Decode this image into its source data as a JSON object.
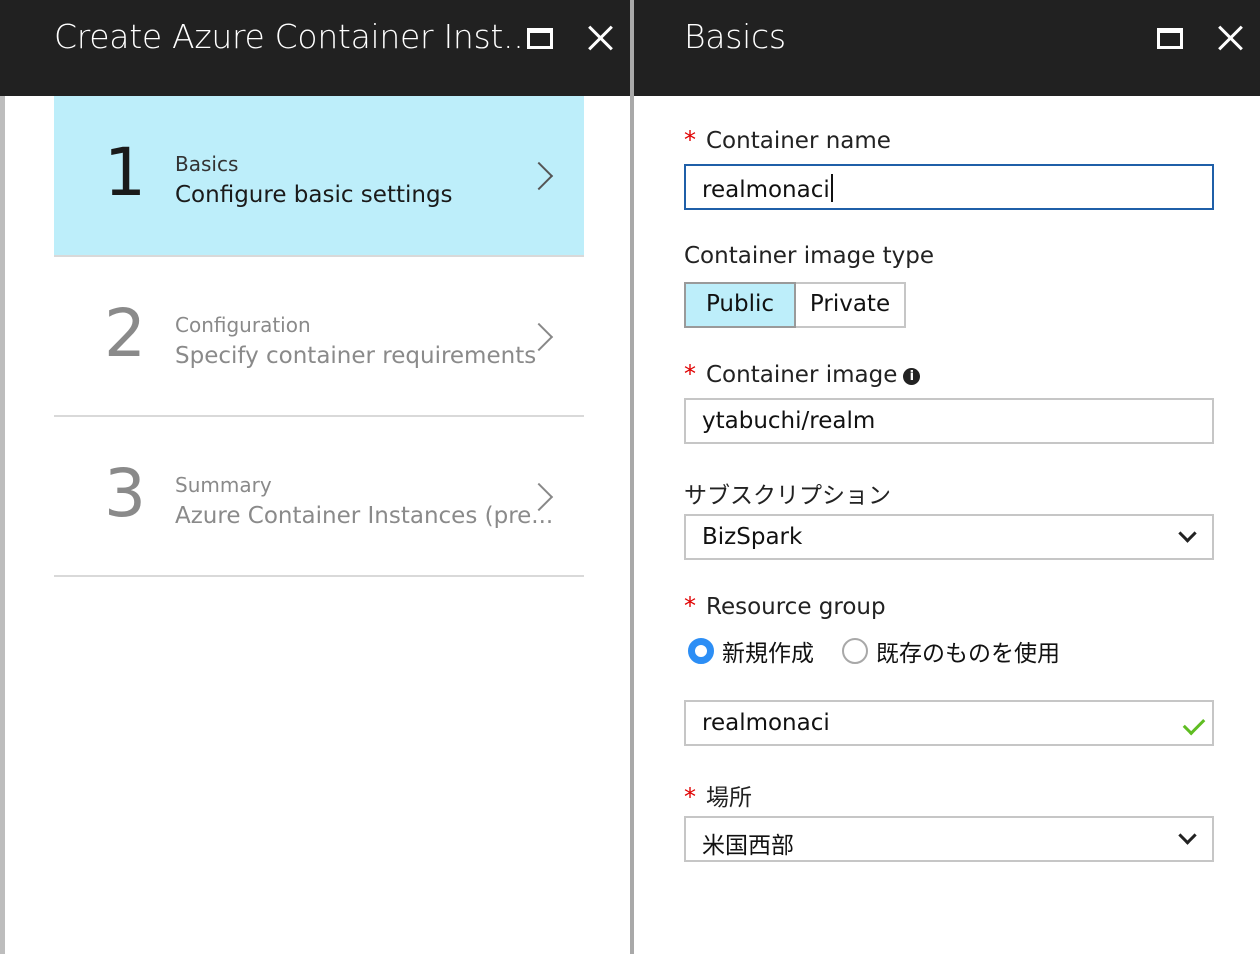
{
  "left_blade": {
    "title": "Create Azure Container Inst...",
    "steps": [
      {
        "number": "1",
        "title": "Basics",
        "subtitle": "Configure basic settings"
      },
      {
        "number": "2",
        "title": "Configuration",
        "subtitle": "Specify container requirements"
      },
      {
        "number": "3",
        "title": "Summary",
        "subtitle": "Azure Container Instances (pre..."
      }
    ]
  },
  "right_blade": {
    "title": "Basics",
    "container_name": {
      "label": "Container name",
      "value": "realmonaci"
    },
    "image_type": {
      "label": "Container image type",
      "options": [
        "Public",
        "Private"
      ],
      "selected": "Public"
    },
    "container_image": {
      "label": "Container image",
      "value": "ytabuchi/realm"
    },
    "subscription": {
      "label": "サブスクリプション",
      "value": "BizSpark"
    },
    "resource_group": {
      "label": "Resource group",
      "options": [
        "新規作成",
        "既存のものを使用"
      ],
      "selected": "新規作成",
      "value": "realmonaci"
    },
    "location": {
      "label": "場所",
      "value": "米国西部"
    }
  },
  "colors": {
    "header_bg": "#212121",
    "active_step_bg": "#bdeefa",
    "required": "#e00000",
    "focus_border": "#1f5fa8",
    "valid_check": "#5fbd22",
    "radio_on": "#2c8ef5"
  }
}
